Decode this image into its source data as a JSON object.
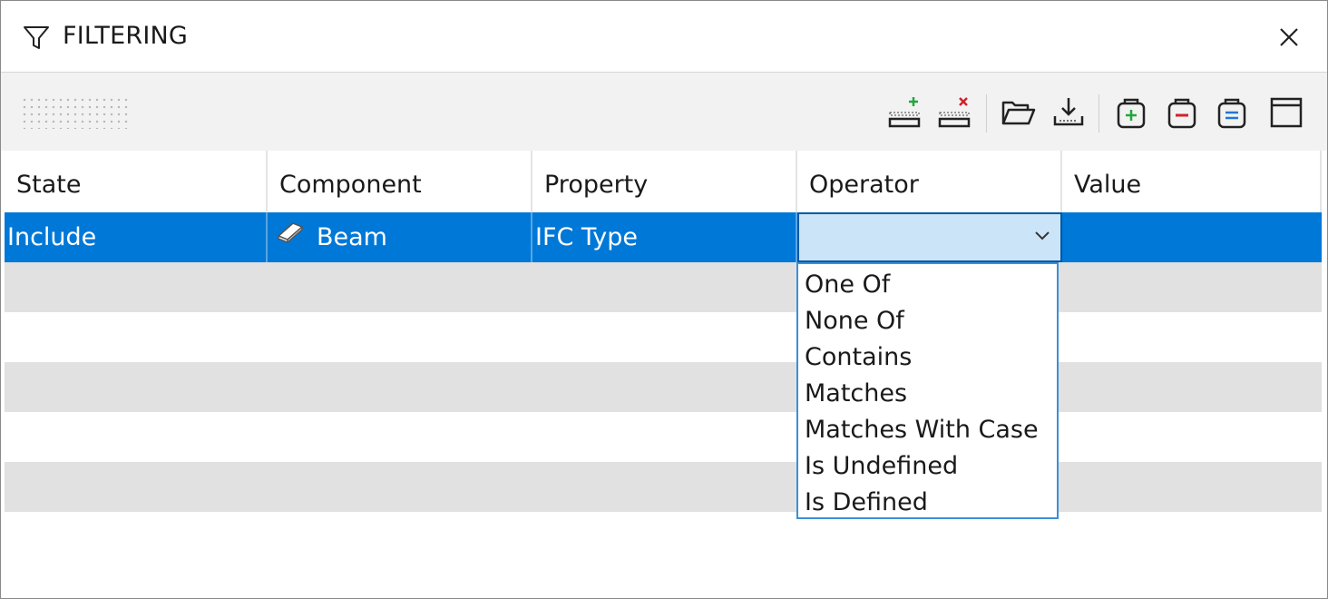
{
  "window": {
    "title": "FILTERING"
  },
  "icons": {
    "title": "filter-funnel-icon",
    "close": "close-x-icon",
    "toolbar": [
      "add-row-icon",
      "delete-row-icon",
      "open-folder-icon",
      "save-download-icon",
      "add-set-icon",
      "remove-set-icon",
      "edit-set-icon",
      "window-panel-icon"
    ],
    "component": "beam-icon"
  },
  "colors": {
    "selection": "#0078d7",
    "operator_cell": "#cce4f7",
    "stripe": "#e1e1e1",
    "add": "#1fa83a",
    "delete": "#d4202a",
    "edit": "#1e78d2"
  },
  "grid": {
    "headers": [
      "State",
      "Component",
      "Property",
      "Operator",
      "Value"
    ],
    "selected_row": {
      "state": "Include",
      "component": "Beam",
      "property": "IFC Type",
      "operator": "",
      "value": ""
    }
  },
  "operator_dropdown": {
    "options": [
      "One Of",
      "None Of",
      "Contains",
      "Matches",
      "Matches With Case",
      "Is Undefined",
      "Is Defined"
    ]
  }
}
